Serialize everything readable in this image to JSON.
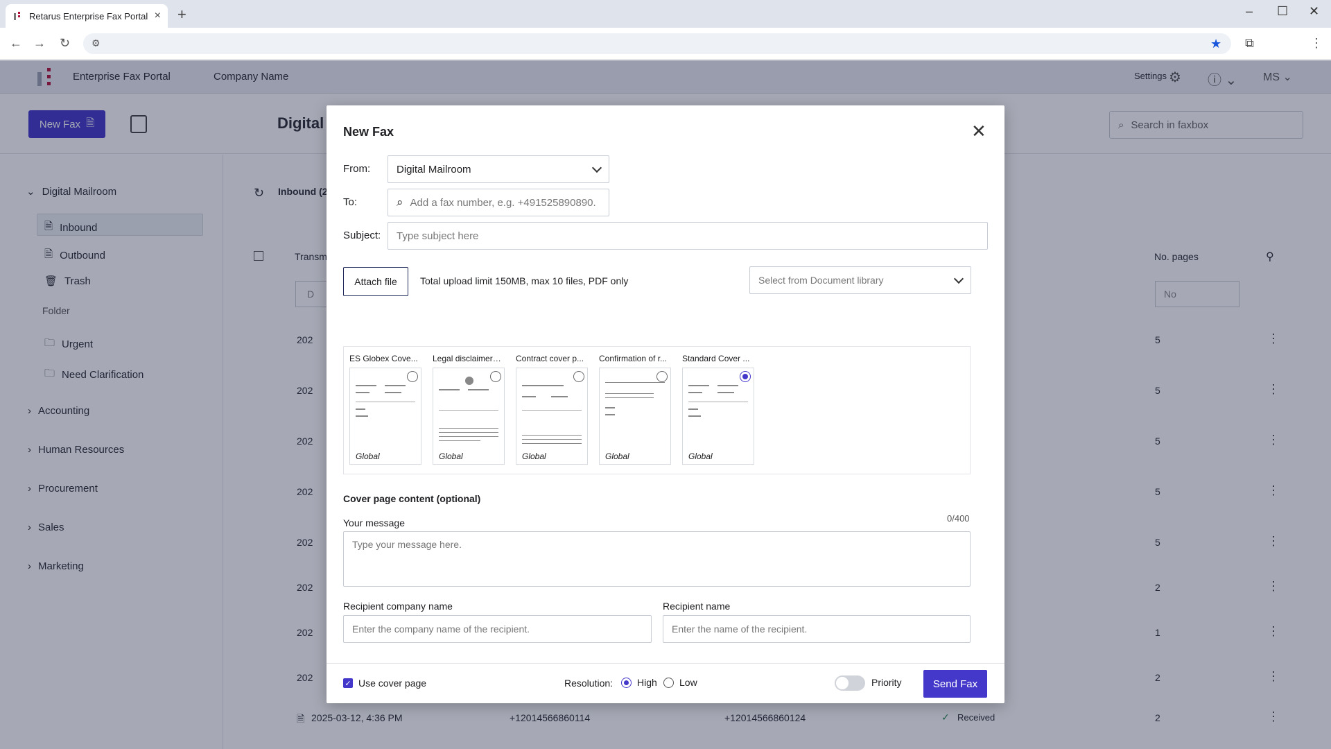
{
  "browser": {
    "tab_title": "Retarus Enterprise Fax Portal Ho",
    "tab_close": "×",
    "new_tab": "+"
  },
  "app": {
    "portal_name": "Enterprise Fax Portal",
    "company_name": "Company Name",
    "settings_label": "Settings",
    "user_initials": "MS"
  },
  "toolbar": {
    "new_fax_label": "New Fax",
    "page_title": "Digital I",
    "search_placeholder": "Search in faxbox"
  },
  "sidebar": {
    "root": "Digital Mailroom",
    "items": [
      "Inbound",
      "Outbound",
      "Trash"
    ],
    "folder_heading": "Folder",
    "folders": [
      "Urgent",
      "Need Clarification"
    ],
    "groups": [
      "Accounting",
      "Human Resources",
      "Procurement",
      "Sales",
      "Marketing"
    ]
  },
  "main": {
    "inbound_label": "Inbound (2",
    "col_transmission": "Transm",
    "col_pages": "No. pages",
    "pages_filter_placeholder": "No",
    "date_filter_partial": "D",
    "rows": [
      {
        "date": "202",
        "pages": "5"
      },
      {
        "date": "202",
        "pages": "5"
      },
      {
        "date": "202",
        "pages": "5"
      },
      {
        "date": "202",
        "pages": "5"
      },
      {
        "date": "202",
        "pages": "5"
      },
      {
        "date": "202",
        "pages": "2"
      },
      {
        "date": "202",
        "pages": "1"
      },
      {
        "date": "202",
        "pages": "2"
      }
    ],
    "last_row": {
      "date": "2025-03-12, 4:36 PM",
      "from": "+12014566860114",
      "to": "+12014566860124",
      "status": "Received",
      "pages": "2"
    }
  },
  "modal": {
    "title": "New Fax",
    "from_label": "From:",
    "from_value": "Digital Mailroom",
    "to_label": "To:",
    "to_placeholder": "Add a fax number, e.g. +491525890890.",
    "subject_label": "Subject:",
    "subject_placeholder": "Type subject here",
    "attach_label": "Attach file",
    "upload_hint": "Total upload limit 150MB, max 10 files, PDF only",
    "doc_library_placeholder": "Select from Document library",
    "covers": [
      {
        "name": "ES Globex Cove...",
        "tag": "Global",
        "selected": false
      },
      {
        "name": "Legal disclaimer ...",
        "tag": "Global",
        "selected": false
      },
      {
        "name": "Contract cover p...",
        "tag": "Global",
        "selected": false
      },
      {
        "name": "Confirmation of r...",
        "tag": "Global",
        "selected": false
      },
      {
        "name": "Standard Cover ...",
        "tag": "Global",
        "selected": true
      }
    ],
    "cover_section_title": "Cover page content (optional)",
    "message_label": "Your message",
    "message_counter": "0/400",
    "message_placeholder": "Type your message here.",
    "recipient_company_label": "Recipient company name",
    "recipient_company_placeholder": "Enter the company name of the recipient.",
    "recipient_name_label": "Recipient name",
    "recipient_name_placeholder": "Enter the name of the recipient.",
    "use_cover_label": "Use cover page",
    "resolution_label": "Resolution:",
    "res_high": "High",
    "res_low": "Low",
    "priority_label": "Priority",
    "send_label": "Send Fax"
  }
}
